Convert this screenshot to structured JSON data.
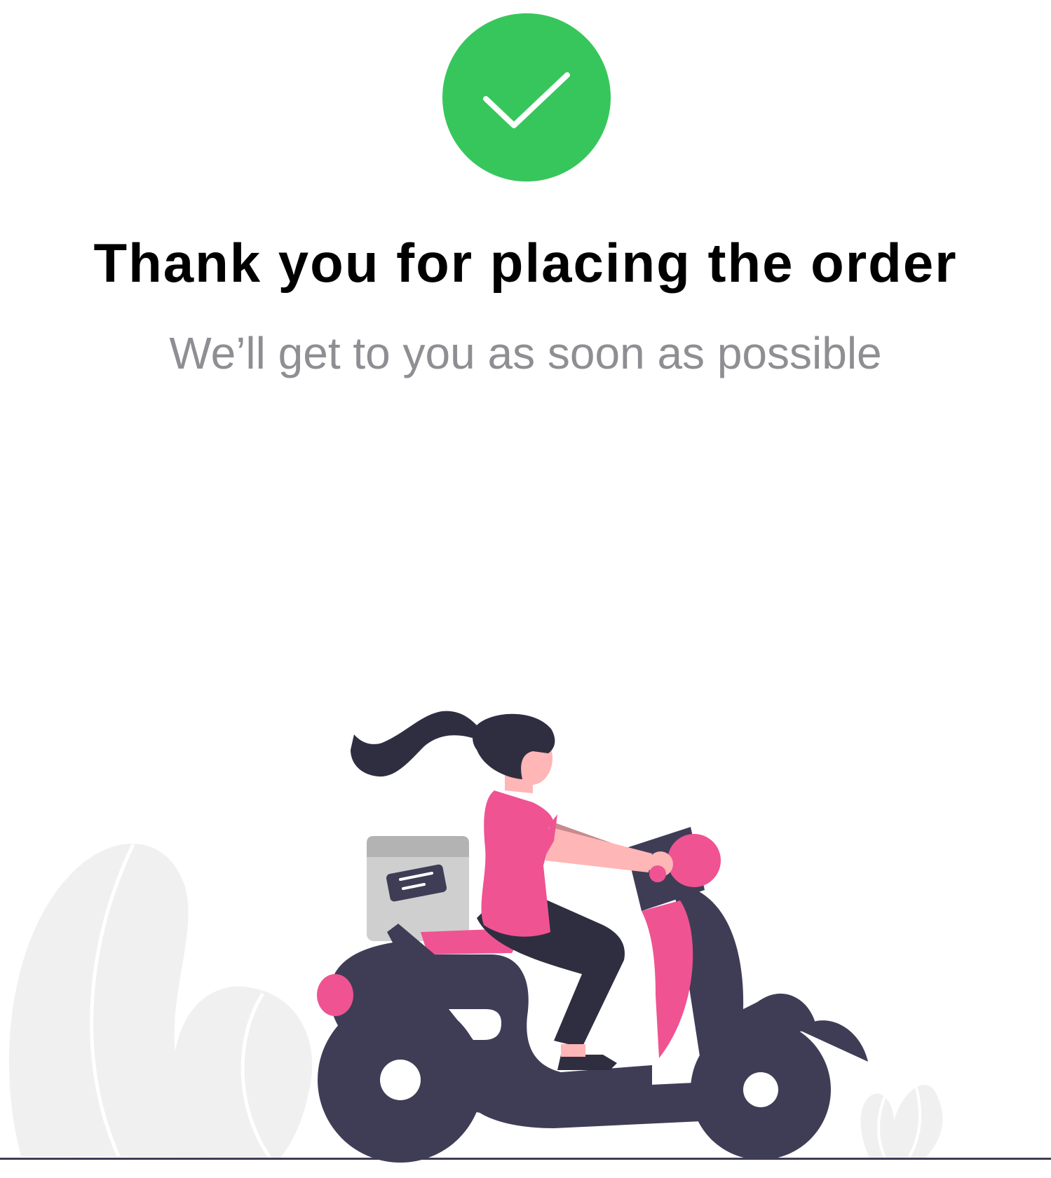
{
  "confirmation": {
    "title": "Thank you for placing the order",
    "subtitle": "We’ll get to you as soon as possible",
    "status_icon": "checkmark-icon",
    "illustration": "delivery-scooter-illustration"
  },
  "colors": {
    "success": "#37c65c",
    "title_text": "#000000",
    "subtitle_text": "#8e8e93",
    "accent_pink": "#ef5392",
    "dark": "#3f3d56",
    "ground": "#3f3d56"
  }
}
